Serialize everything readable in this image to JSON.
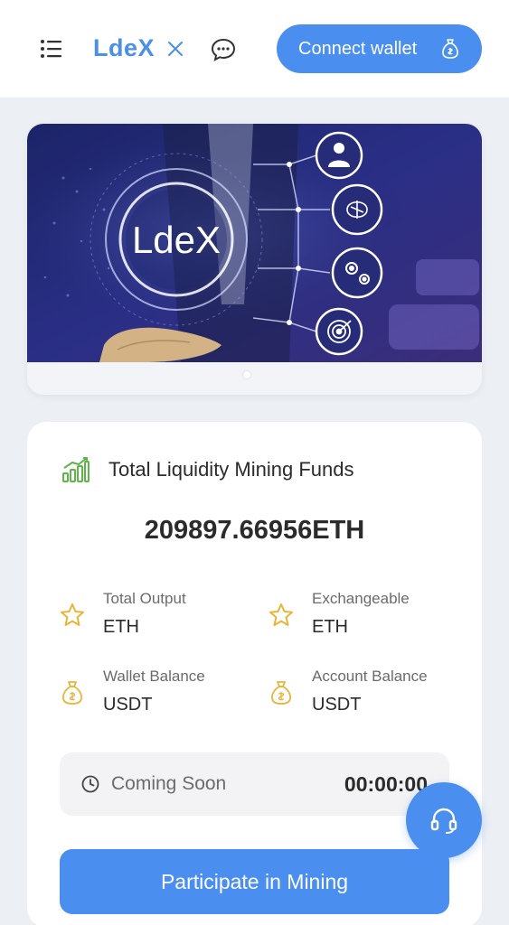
{
  "header": {
    "logo": "LdeX",
    "connect_wallet_label": "Connect wallet"
  },
  "banner": {
    "logo_text": "LdeX",
    "slide_count": 1,
    "active_slide": 1
  },
  "mining": {
    "title": "Total Liquidity Mining Funds",
    "total_amount": "209897.66956ETH",
    "stats": [
      {
        "label": "Total Output",
        "value": "ETH",
        "icon": "star-icon"
      },
      {
        "label": "Exchangeable",
        "value": "ETH",
        "icon": "star-icon"
      },
      {
        "label": "Wallet Balance",
        "value": "USDT",
        "icon": "money-bag-icon"
      },
      {
        "label": "Account Balance",
        "value": "USDT",
        "icon": "money-bag-icon"
      }
    ],
    "countdown_label": "Coming Soon",
    "countdown_timer": "00:00:00",
    "participate_label": "Participate in Mining"
  },
  "colors": {
    "accent": "#4a8ff0",
    "star": "#e8b53a",
    "chart_icon": "#5fb54a",
    "text": "#2b2b2b",
    "muted": "#6b6b6b"
  },
  "icons": {
    "menu": "hamburger-menu-icon",
    "close": "close-icon",
    "chat": "chat-bubble-icon",
    "wallet": "money-bag-icon",
    "chart": "bar-chart-growth-icon",
    "clock": "clock-icon",
    "support": "headset-icon"
  }
}
